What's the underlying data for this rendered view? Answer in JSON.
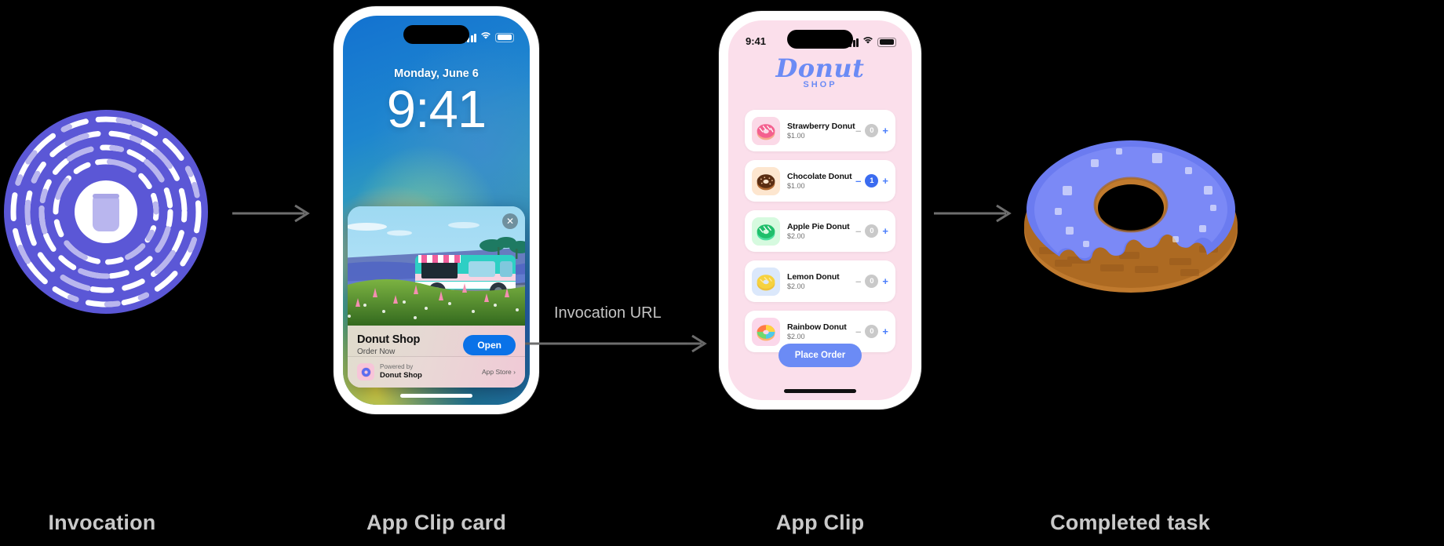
{
  "diagram": {
    "title": "App Clip invocation flow",
    "background": "#000000",
    "caption_color": "#c9c9c9",
    "steps": [
      {
        "id": "invocation",
        "label": "Invocation"
      },
      {
        "id": "app-clip-card",
        "label": "App Clip card"
      },
      {
        "id": "app-clip",
        "label": "App Clip"
      },
      {
        "id": "completed-task",
        "label": "Completed task"
      }
    ],
    "connectors": [
      {
        "id": "arrow-1",
        "label": ""
      },
      {
        "id": "arrow-2",
        "label": "Invocation URL"
      },
      {
        "id": "arrow-3",
        "label": ""
      }
    ]
  },
  "invocation": {
    "icon_name": "app-clip-code-icon",
    "ring_color": "#5b57d6",
    "dash_light": "#ffffff",
    "dash_muted": "#b9b6ee",
    "center_phone_color": "#b9b6ee"
  },
  "lock_phone": {
    "status_bar": {
      "time": "",
      "signal_icon": "cellular-bars-icon",
      "wifi_icon": "wifi-icon",
      "battery_icon": "battery-icon"
    },
    "lock_screen": {
      "date": "Monday, June 6",
      "time": "9:41"
    },
    "clip_card": {
      "close_icon": "close-icon",
      "hero_image_name": "donut-food-truck-illustration",
      "title": "Donut Shop",
      "subtitle": "Order Now",
      "open_button": "Open",
      "footer": {
        "powered_by_label": "Powered by",
        "developer_name": "Donut Shop",
        "app_icon_name": "donut-app-icon",
        "store_label": "App Store",
        "chevron_icon": "chevron-right-icon"
      }
    }
  },
  "clip_phone": {
    "status_bar": {
      "time": "9:41",
      "signal_icon": "cellular-bars-icon",
      "wifi_icon": "wifi-icon",
      "battery_icon": "battery-icon"
    },
    "logo": {
      "main": "Donut",
      "sub": "SHOP",
      "color": "#6b8bf5"
    },
    "items": [
      {
        "name": "Strawberry Donut",
        "price": "$1.00",
        "qty": "0",
        "thumb_bg": "#fbd9e7",
        "icon_name": "strawberry-donut-icon",
        "glaze": "#f4608f",
        "drizzle": "#ffffff",
        "dough": "#f6a98d"
      },
      {
        "name": "Chocolate Donut",
        "price": "$1.00",
        "qty": "1",
        "thumb_bg": "#fde6cf",
        "icon_name": "chocolate-donut-icon",
        "glaze": "#5a2d12",
        "drizzle": "#f2c9a0",
        "dough": "#b06a33"
      },
      {
        "name": "Apple Pie Donut",
        "price": "$2.00",
        "qty": "0",
        "thumb_bg": "#d6fadf",
        "icon_name": "apple-pie-donut-icon",
        "glaze": "#1fbf6b",
        "drizzle": "#ffffff",
        "dough": "#4de0a0"
      },
      {
        "name": "Lemon Donut",
        "price": "$2.00",
        "qty": "0",
        "thumb_bg": "#dbe8fb",
        "icon_name": "lemon-donut-icon",
        "glaze": "#f6d23f",
        "drizzle": "#ffeaa0",
        "dough": "#efc23a"
      },
      {
        "name": "Rainbow Donut",
        "price": "$2.00",
        "qty": "0",
        "thumb_bg": "#fbd7ea",
        "icon_name": "rainbow-donut-icon",
        "glaze": "#ff7a45",
        "drizzle": "#ffffff",
        "dough": "#ffb36b"
      }
    ],
    "stepper": {
      "minus_label": "–",
      "plus_label": "+",
      "active_color": "#3b6cf0",
      "inactive_color": "#c9c9c9"
    },
    "place_order_button": "Place Order"
  },
  "completed_task": {
    "icon_name": "blue-glazed-donut-icon",
    "glaze_color": "#6b7bf0",
    "dough_color": "#c07a2e"
  }
}
